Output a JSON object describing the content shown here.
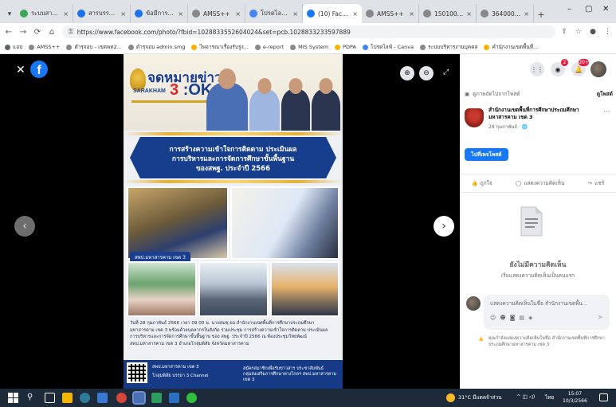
{
  "browser": {
    "tabs": [
      {
        "title": "ระบบสารบรร...",
        "favicon_color": "#3aa655"
      },
      {
        "title": "สารบรรณ...",
        "favicon_color": "#1a73e8"
      },
      {
        "title": "ข้อมีการแนะ",
        "favicon_color": "#1a73e8"
      },
      {
        "title": "AMSS++",
        "favicon_color": "#888888"
      },
      {
        "title": "โปรดไลฟ์ - Ca...",
        "favicon_color": "#4285f4"
      },
      {
        "title": "(10) Faceb...",
        "favicon_color": "#1877f2"
      },
      {
        "title": "AMSS++",
        "favicon_color": "#888888"
      },
      {
        "title": "15010011...",
        "favicon_color": "#888888"
      },
      {
        "title": "36400001...",
        "favicon_color": "#888888"
      }
    ],
    "new_tab": "+",
    "url": "https://www.facebook.com/photo/?fbid=1028833552604024&set=pcb.1028833233597889",
    "bookmarks": [
      {
        "label": "แอป",
        "color": "#5f6368"
      },
      {
        "label": "AMSS++",
        "color": "#888888"
      },
      {
        "label": "ตำรุจอบ - เขตพท2...",
        "color": "#888888"
      },
      {
        "label": "ตำรุจอบ admin.smg",
        "color": "#888888"
      },
      {
        "label": "ไพจารณาเรื่องรับรูง...",
        "color": "#f4b400"
      },
      {
        "label": "e-report",
        "color": "#888888"
      },
      {
        "label": "MIS System",
        "color": "#888888"
      },
      {
        "label": "PDPA",
        "color": "#f4b400"
      },
      {
        "label": "โปรดไลฟ์ - Canva",
        "color": "#4285f4"
      },
      {
        "label": "ระบบบริหารงานบุคคล",
        "color": "#888888"
      },
      {
        "label": "คำนักงานเขตพื้นที่...",
        "color": "#f4b400"
      }
    ]
  },
  "poster": {
    "header_title": "จดหมายข่าว",
    "brand_small": "SARAKHAM",
    "brand_num": "3",
    "brand_ok": ":OK",
    "banner_line1": "การสร้างความเข้าใจการติดตาม ประเมินผล",
    "banner_line2": "การบริหารและการจัดการศึกษาขั้นพื้นฐาน",
    "banner_line3": "ของสพฐ. ประจำปี 2566",
    "photo_tag": "สพป.มหาสารคาม เขต 3",
    "body_text": "วันที่ 28 กุมภาพันธ์ 2566 เวลา 09.00 น. นายสมชุ ผอ.สำนักงานเขตพื้นที่การศึกษาประถมศึกษามหาสารคาม เขต 3 พร้อมด้วยบุคลากรในสังกัด ร่วมประชุม การสร้างความเข้าใจการติดตาม ประเมินผล การบริหารและการจัดการศึกษาขั้นพื้นฐาน ของ สพฐ. ประจำปี 2566 ณ ห้องประชุมวิทยพัฒน์ สพป.มหาสารคาม เขต 3 อำเภอโกสุมพิสัย จังหวัดมหาสารคาม",
    "footer_page": "สพป.มหาสารคาม เขต 3",
    "footer_channel": "โกสุมพิสัย บรรยา 3 Channel",
    "footer_right": "สมัครสมาชิกเพื่อรับข่าวสาร ประชาสัมพันธ์\nกลุ่มส่งเสริมการศึกษาทางไกลฯ สพป.มหาสารคาม เขต 3"
  },
  "sidebar": {
    "search_label": "ดูภาพถัดไปจากโพสต์",
    "search_link": "ดูโพสต์",
    "page_name": "สำนักงานเขตพื้นที่การศึกษาประถมศึกษามหาสารคาม เขต 3",
    "post_date": "28 กุมภาพันธ์ ·",
    "follow_label": "ไปที่เพจโพสต์",
    "like_label": "ถูกใจ",
    "comment_label": "แสดงความคิดเห็น",
    "share_label": "แชร์",
    "empty_title": "ยังไม่มีความคิดเห็น",
    "empty_sub": "เริ่มแสดงความคิดเห็นเป็นคนแรก",
    "comment_placeholder": "แสดงความคิดเห็นในชื่อ สำนักงานเขตพื้น...",
    "warning_text": "คุณกำลังแสดงความคิดเห็นในชื่อ สำนักงานเขตพื้นที่การศึกษา ประถมศึกษามหาสารคาม เขต 3",
    "badges": {
      "messenger": "2",
      "notifications": "20+"
    }
  },
  "taskbar": {
    "weather": "31°C มีแดดจ้าส่วน",
    "lang": "ไทย",
    "time": "15:07",
    "date": "10/3/2566"
  },
  "colors": {
    "fb_blue": "#1877f2",
    "poster_navy": "#163a86",
    "gold": "#d4a226"
  }
}
